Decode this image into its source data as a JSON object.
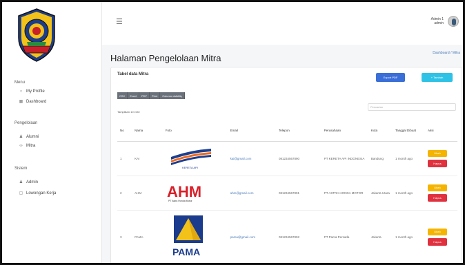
{
  "header": {
    "hamburger_icon": "menu-icon",
    "user_name": "Admin 1",
    "user_role": "admin"
  },
  "page": {
    "title": "Halaman Pengelolaan Mitra",
    "breadcrumb": "Dashboard / Mitra"
  },
  "sidebar": {
    "sections": [
      {
        "label": "Menu",
        "items": [
          {
            "label": "My Profile",
            "icon": "user-icon"
          },
          {
            "label": "Dashboard",
            "icon": "dashboard-icon"
          }
        ]
      },
      {
        "label": "Pengelolaan",
        "items": [
          {
            "label": "Alumni",
            "icon": "users-icon"
          },
          {
            "label": "Mitra",
            "icon": "handshake-icon"
          }
        ]
      },
      {
        "label": "Sistem",
        "items": [
          {
            "label": "Admin",
            "icon": "admin-icon"
          },
          {
            "label": "Lowongan Kerja",
            "icon": "briefcase-icon"
          }
        ]
      }
    ]
  },
  "card": {
    "title": "Tabel data Mitra",
    "export_pdf": "Export PDF",
    "add": "+ Tambah"
  },
  "datatable": {
    "buttons": [
      "CSV",
      "Excel",
      "PDF",
      "Print",
      "Column visibility"
    ],
    "show_entries": "Tampilkan 10 entri",
    "search_placeholder": "Pencarian"
  },
  "table": {
    "columns": [
      "No",
      "Nama",
      "Foto",
      "Email",
      "Telepon",
      "Perusahaan",
      "Kota",
      "Tanggal Dibuat",
      "Aksi"
    ],
    "rows": [
      {
        "no": "1",
        "nama": "KAI",
        "logo": "kai-logo",
        "logo_text": "KERETA API",
        "email": "kai@gmail.com",
        "telepon": "081234567890",
        "perusahaan": "PT KERETA API INDONESIA",
        "kota": "Bandung",
        "tanggal": "1 month ago"
      },
      {
        "no": "2",
        "nama": "AHM",
        "logo": "ahm-logo",
        "logo_text": "AHM",
        "logo_sub": "PT Astra Honda Motor",
        "email": "ahm@gmail.com",
        "telepon": "081234567891",
        "perusahaan": "PT ASTRA HONDA MOTOR",
        "kota": "Jakarta Utara",
        "tanggal": "1 month ago"
      },
      {
        "no": "3",
        "nama": "PAMA",
        "logo": "pama-logo",
        "logo_text": "PAMA",
        "email": "pama@gmail.com",
        "telepon": "081234567892",
        "perusahaan": "PT Pama Persada",
        "kota": "Jakarta",
        "tanggal": "1 month ago"
      }
    ],
    "edit_label": "Ubah",
    "delete_label": "Hapus"
  },
  "colors": {
    "pdf_button": "#3b6fd8",
    "add_button": "#2ec3e6",
    "edit_button": "#f4b400",
    "delete_button": "#e0313f",
    "ahm_red": "#d9202a",
    "kai_blue": "#1d3f8f",
    "kai_orange": "#f06a1d",
    "pama_yellow": "#f2c21b",
    "pama_blue": "#1b3c8c"
  }
}
